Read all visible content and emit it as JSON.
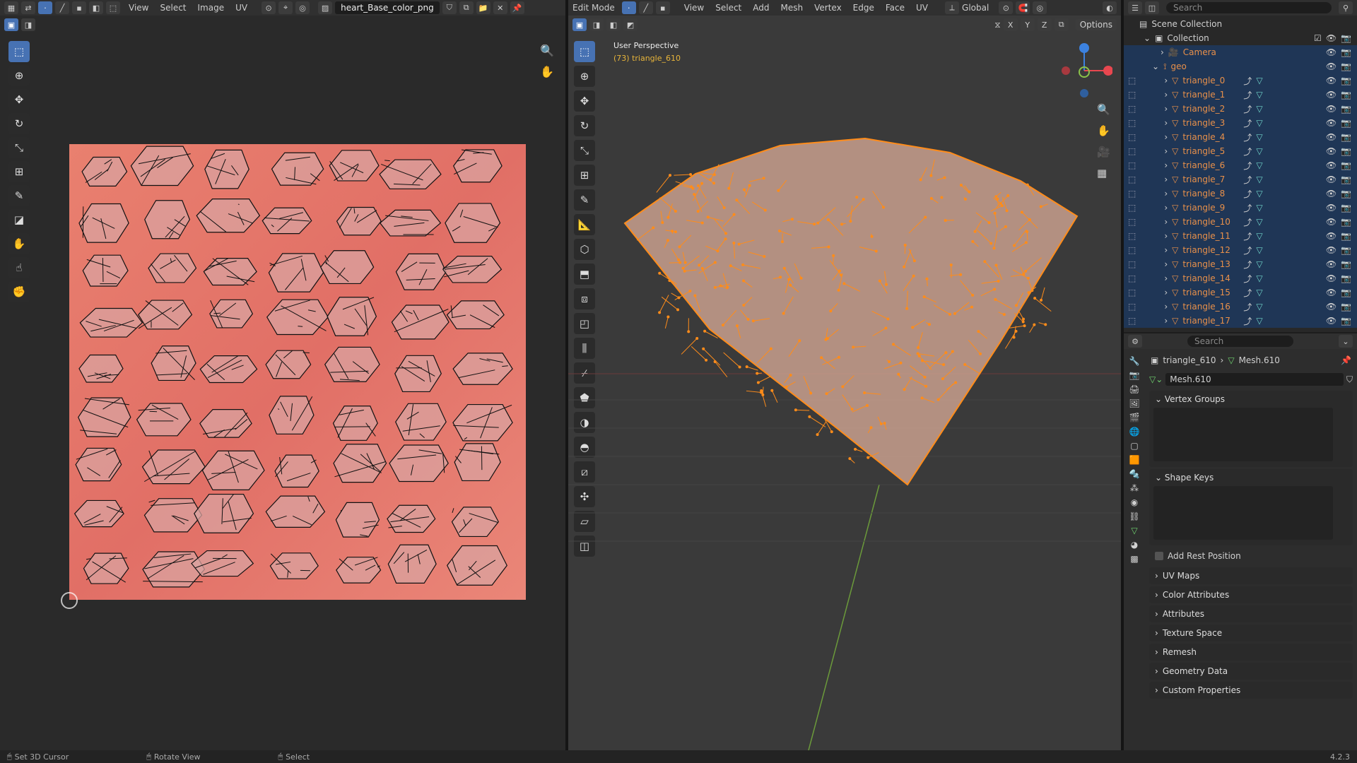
{
  "uv_editor": {
    "menus": [
      "View",
      "Select",
      "Image",
      "UV"
    ],
    "image_name": "heart_Base_color_png"
  },
  "viewport": {
    "mode": "Edit Mode",
    "menus": [
      "View",
      "Select",
      "Add",
      "Mesh",
      "Vertex",
      "Edge",
      "Face",
      "UV"
    ],
    "orientation": "Global",
    "options_label": "Options",
    "perspective_label": "User Perspective",
    "object_label": "(73) triangle_610",
    "axes": [
      "X",
      "Y",
      "Z"
    ]
  },
  "outliner": {
    "search_placeholder": "Search",
    "scene_collection": "Scene Collection",
    "collection": "Collection",
    "camera": "Camera",
    "geo": "geo",
    "items": [
      "triangle_0",
      "triangle_1",
      "triangle_2",
      "triangle_3",
      "triangle_4",
      "triangle_5",
      "triangle_6",
      "triangle_7",
      "triangle_8",
      "triangle_9",
      "triangle_10",
      "triangle_11",
      "triangle_12",
      "triangle_13",
      "triangle_14",
      "triangle_15",
      "triangle_16",
      "triangle_17"
    ]
  },
  "properties": {
    "search_placeholder": "Search",
    "breadcrumb_object": "triangle_610",
    "breadcrumb_mesh": "Mesh.610",
    "mesh_name": "Mesh.610",
    "vertex_groups": "Vertex Groups",
    "shape_keys": "Shape Keys",
    "add_rest_position": "Add Rest Position",
    "collapsed_panels": [
      "UV Maps",
      "Color Attributes",
      "Attributes",
      "Texture Space",
      "Remesh",
      "Geometry Data",
      "Custom Properties"
    ]
  },
  "status_bar": {
    "left": "Set 3D Cursor",
    "middle": "Rotate View",
    "right": "Select",
    "version": "4.2.3"
  },
  "colors": {
    "accent": "#4772b3",
    "selection_orange": "#ff8c1a",
    "uv_texture": "#e87d72",
    "axis_x": "#e8474f",
    "axis_y": "#8bc34a",
    "axis_z": "#3c82e0"
  }
}
